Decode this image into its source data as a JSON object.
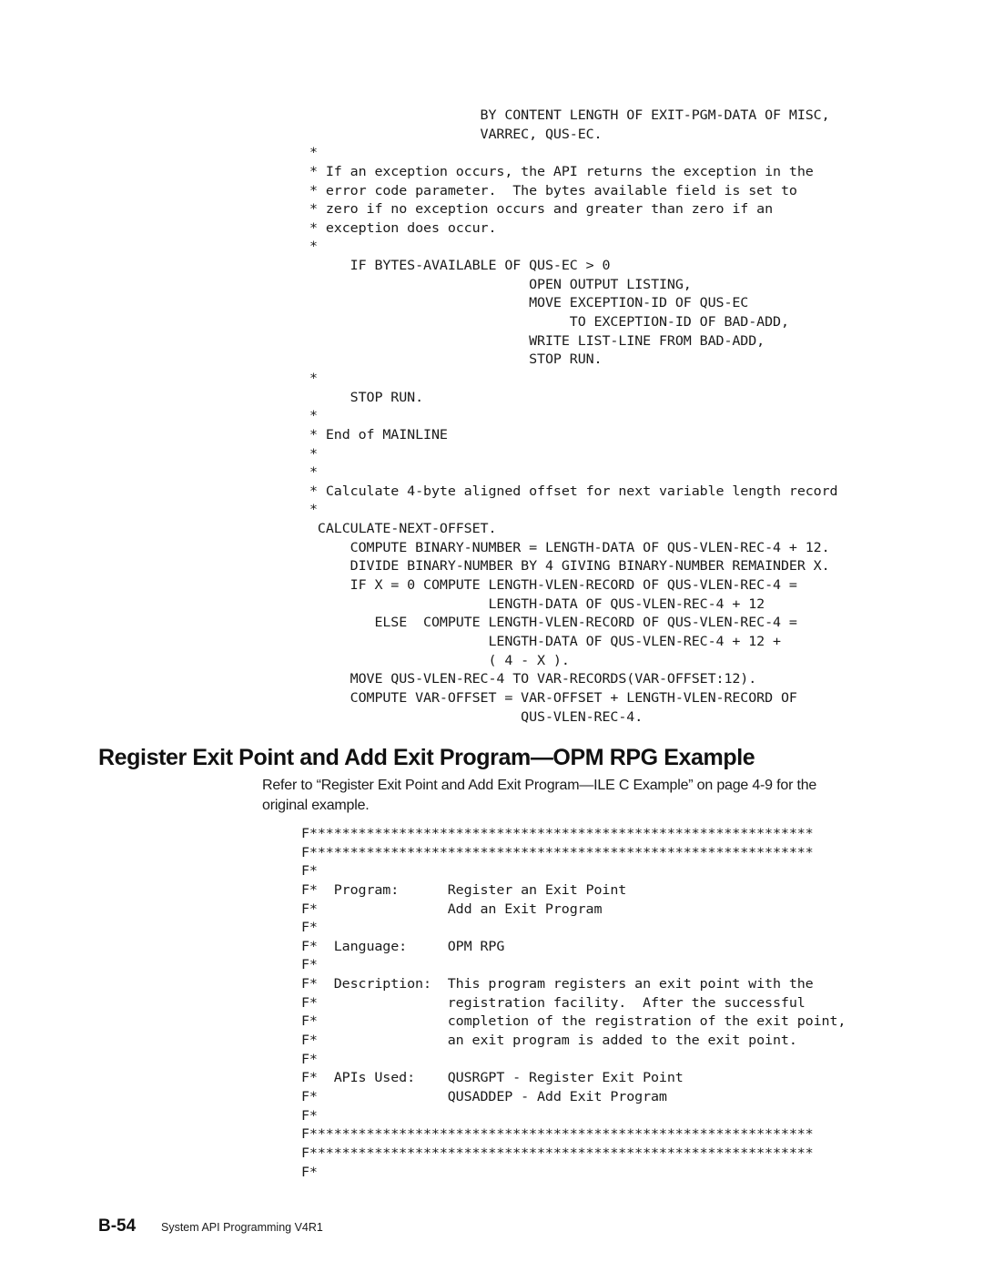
{
  "code_continuation": {
    "lines": [
      "                     BY CONTENT LENGTH OF EXIT-PGM-DATA OF MISC,",
      "                     VARREC, QUS-EC.",
      "*",
      "* If an exception occurs, the API returns the exception in the",
      "* error code parameter.  The bytes available field is set to",
      "* zero if no exception occurs and greater than zero if an",
      "* exception does occur.",
      "*",
      "     IF BYTES-AVAILABLE OF QUS-EC > 0",
      "                           OPEN OUTPUT LISTING,",
      "                           MOVE EXCEPTION-ID OF QUS-EC",
      "                                TO EXCEPTION-ID OF BAD-ADD,",
      "                           WRITE LIST-LINE FROM BAD-ADD,",
      "                           STOP RUN.",
      "*",
      "     STOP RUN.",
      "*",
      "* End of MAINLINE",
      "*",
      "*",
      "* Calculate 4-byte aligned offset for next variable length record",
      "*",
      " CALCULATE-NEXT-OFFSET.",
      "     COMPUTE BINARY-NUMBER = LENGTH-DATA OF QUS-VLEN-REC-4 + 12.",
      "     DIVIDE BINARY-NUMBER BY 4 GIVING BINARY-NUMBER REMAINDER X.",
      "     IF X = 0 COMPUTE LENGTH-VLEN-RECORD OF QUS-VLEN-REC-4 =",
      "                      LENGTH-DATA OF QUS-VLEN-REC-4 + 12",
      "        ELSE  COMPUTE LENGTH-VLEN-RECORD OF QUS-VLEN-REC-4 =",
      "                      LENGTH-DATA OF QUS-VLEN-REC-4 + 12 +",
      "                      ( 4 - X ).",
      "     MOVE QUS-VLEN-REC-4 TO VAR-RECORDS(VAR-OFFSET:12).",
      "     COMPUTE VAR-OFFSET = VAR-OFFSET + LENGTH-VLEN-RECORD OF",
      "                          QUS-VLEN-REC-4."
    ]
  },
  "section": {
    "heading": "Register Exit Point and Add Exit Program—OPM RPG Example",
    "intro_prefix": "Refer to ",
    "intro_ref": "“Register Exit Point and Add Exit Program—ILE C Example” on page  4-9",
    "intro_suffix": " for the original example."
  },
  "rpg_code": {
    "lines": [
      "F**************************************************************",
      "F**************************************************************",
      "F*",
      "F*  Program:      Register an Exit Point",
      "F*                Add an Exit Program",
      "F*",
      "F*  Language:     OPM RPG",
      "F*",
      "F*  Description:  This program registers an exit point with the",
      "F*                registration facility.  After the successful",
      "F*                completion of the registration of the exit point,",
      "F*                an exit program is added to the exit point.",
      "F*",
      "F*  APIs Used:    QUSRGPT - Register Exit Point",
      "F*                QUSADDEP - Add Exit Program",
      "F*",
      "F**************************************************************",
      "F**************************************************************",
      "F*"
    ]
  },
  "footer": {
    "page_number": "B-54",
    "book_title": "System API Programming V4R1"
  }
}
